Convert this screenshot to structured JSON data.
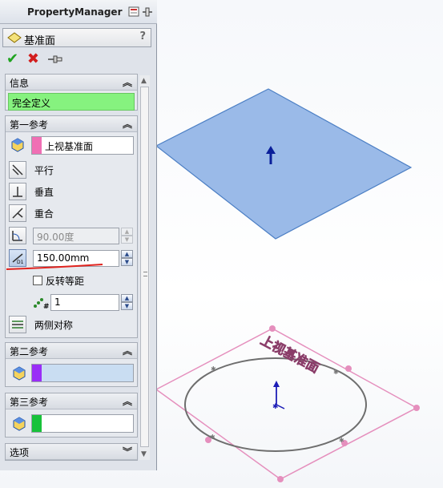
{
  "panel": {
    "title": "PropertyManager",
    "feature_name": "基准面",
    "help": "?",
    "ok_icon": "check-icon",
    "cancel_icon": "x-icon",
    "pin_icon": "pushpin-icon"
  },
  "info": {
    "title": "信息",
    "status": "完全定义",
    "status_color": "#86f27f"
  },
  "first_ref": {
    "title": "第一参考",
    "selection": "上视基准面",
    "selection_color": "#f06fb4",
    "options": {
      "parallel": "平行",
      "perpendicular": "垂直",
      "coincident": "重合"
    },
    "angle": "90.00度",
    "distance": "150.00mm",
    "flip_label": "反转等距",
    "count": "1",
    "symmetric_label": "两侧对称"
  },
  "second_ref": {
    "title": "第二参考",
    "selection_color": "#9a2ef7"
  },
  "third_ref": {
    "title": "第三参考",
    "selection_color": "#18c23a"
  },
  "options": {
    "title": "选项"
  },
  "viewport": {
    "plane_label": "上视基准面",
    "new_plane_color": "#8fb3e6",
    "ref_plane_color": "#e68fbd"
  }
}
